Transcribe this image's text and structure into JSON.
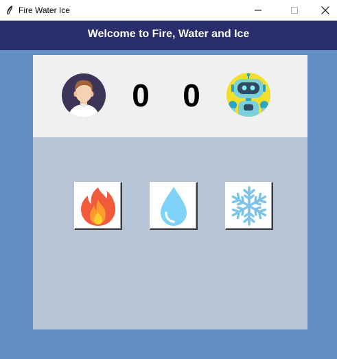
{
  "window": {
    "title": "Fire Water Ice",
    "app_icon": "feather-icon",
    "controls": [
      "minimize-icon",
      "maximize-icon",
      "close-icon"
    ]
  },
  "header": {
    "title": "Welcome to Fire, Water and Ice"
  },
  "scoreboard": {
    "player_avatar": "user-avatar-icon",
    "player_score": "0",
    "bot_score": "0",
    "bot_avatar": "robot-avatar-icon"
  },
  "choices": [
    {
      "id": "fire",
      "icon": "fire-icon"
    },
    {
      "id": "water",
      "icon": "water-drop-icon"
    },
    {
      "id": "ice",
      "icon": "snowflake-icon"
    }
  ],
  "colors": {
    "background": "#6390c3",
    "header": "#2a2d6c",
    "score_bar": "#f0f0f0",
    "choices_area": "#b7c4d6"
  }
}
